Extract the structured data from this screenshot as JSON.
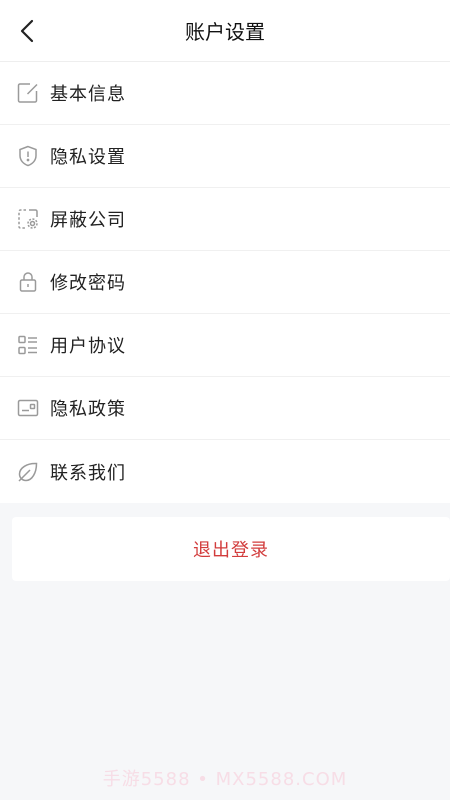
{
  "header": {
    "title": "账户设置",
    "back_icon": "chevron-left-icon"
  },
  "menu": {
    "items": [
      {
        "label": "基本信息",
        "icon": "edit-icon"
      },
      {
        "label": "隐私设置",
        "icon": "shield-icon"
      },
      {
        "label": "屏蔽公司",
        "icon": "block-settings-icon"
      },
      {
        "label": "修改密码",
        "icon": "lock-icon"
      },
      {
        "label": "用户协议",
        "icon": "list-icon"
      },
      {
        "label": "隐私政策",
        "icon": "card-icon"
      },
      {
        "label": "联系我们",
        "icon": "leaf-icon"
      }
    ]
  },
  "logout": {
    "label": "退出登录"
  },
  "watermark": {
    "text": "手游5588 • MX5588.COM"
  },
  "colors": {
    "background": "#f6f7f9",
    "card": "#ffffff",
    "logout_text": "#d23c3c",
    "icon_stroke": "#9a9a9a"
  }
}
